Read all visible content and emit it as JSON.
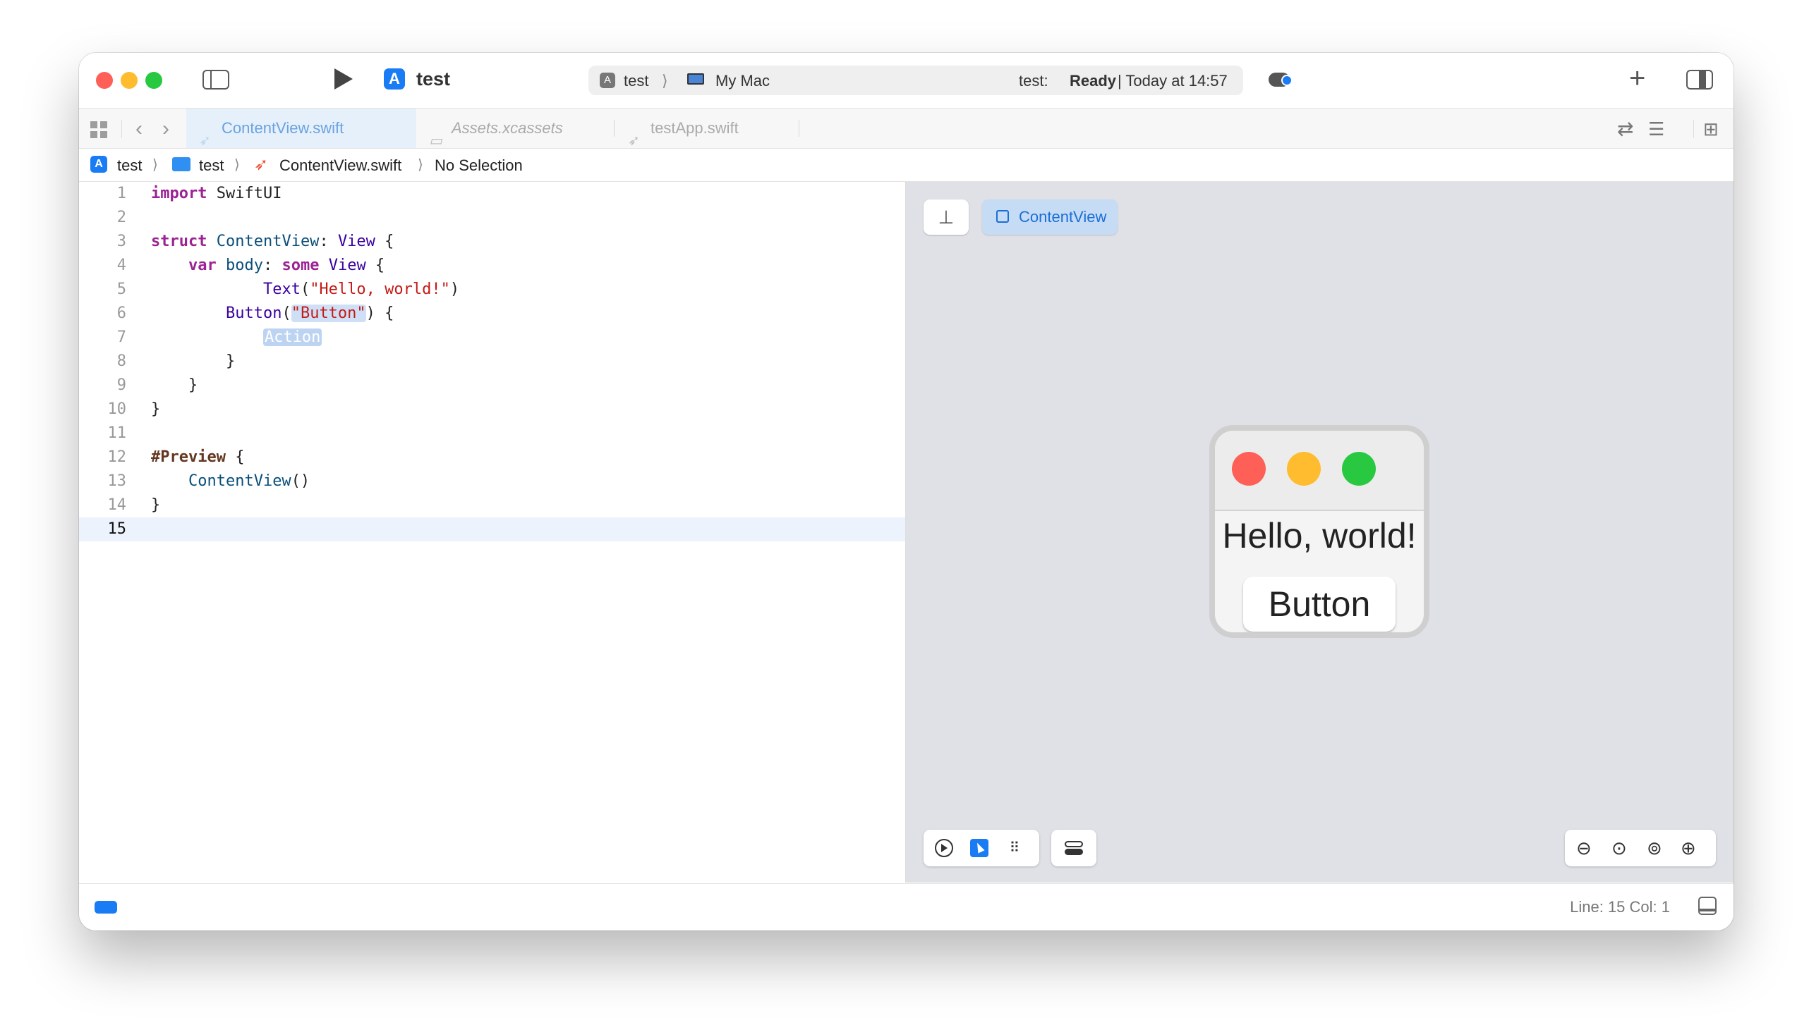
{
  "window": {
    "scheme": "test",
    "activity": {
      "target": "test",
      "destination": "My Mac",
      "status_prefix": "test:",
      "status_bold": "Ready",
      "status_suffix": "| Today at 14:57"
    }
  },
  "tabs": [
    {
      "label": "ContentView.swift",
      "active": true
    },
    {
      "label": "Assets.xcassets",
      "active": false
    },
    {
      "label": "testApp.swift",
      "active": false
    }
  ],
  "breadcrumb": [
    "test",
    "test",
    "ContentView.swift",
    "No Selection"
  ],
  "editor": {
    "line_numbers": [
      "1",
      "2",
      "3",
      "4",
      "5",
      "6",
      "7",
      "8",
      "9",
      "10",
      "11",
      "12",
      "13",
      "14",
      "15"
    ],
    "current_line": 15,
    "code": {
      "l1_kw": "import",
      "l1_rest": " SwiftUI",
      "l3_kw": "struct",
      "l3_name": "ContentView",
      "l3_colon": ": ",
      "l3_type": "View",
      "l3_rest": " {",
      "l4_kw": "var",
      "l4_name": "body",
      "l4_colon": ": ",
      "l4_kw2": "some",
      "l4_type": "View",
      "l4_rest": " {",
      "l5_fn": "Text",
      "l5_open": "(",
      "l5_str": "\"Hello, world!\"",
      "l5_close": ")",
      "l6_fn": "Button",
      "l6_open": "(",
      "l6_str": "\"Button\"",
      "l6_close": ") {",
      "l7_placeholder": "Action",
      "l8": "}",
      "l9": "}",
      "l10": "}",
      "l12_macro": "#Preview",
      "l12_rest": " {",
      "l13_fn": "ContentView",
      "l13_rest": "()",
      "l14": "}"
    }
  },
  "canvas": {
    "preview_chip": "ContentView",
    "preview": {
      "text": "Hello, world!",
      "button": "Button"
    },
    "colors": {
      "red": "#fe5f57",
      "yellow": "#febc2e",
      "green": "#28c840"
    }
  },
  "statusbar": {
    "position": "Line: 15  Col: 1"
  }
}
